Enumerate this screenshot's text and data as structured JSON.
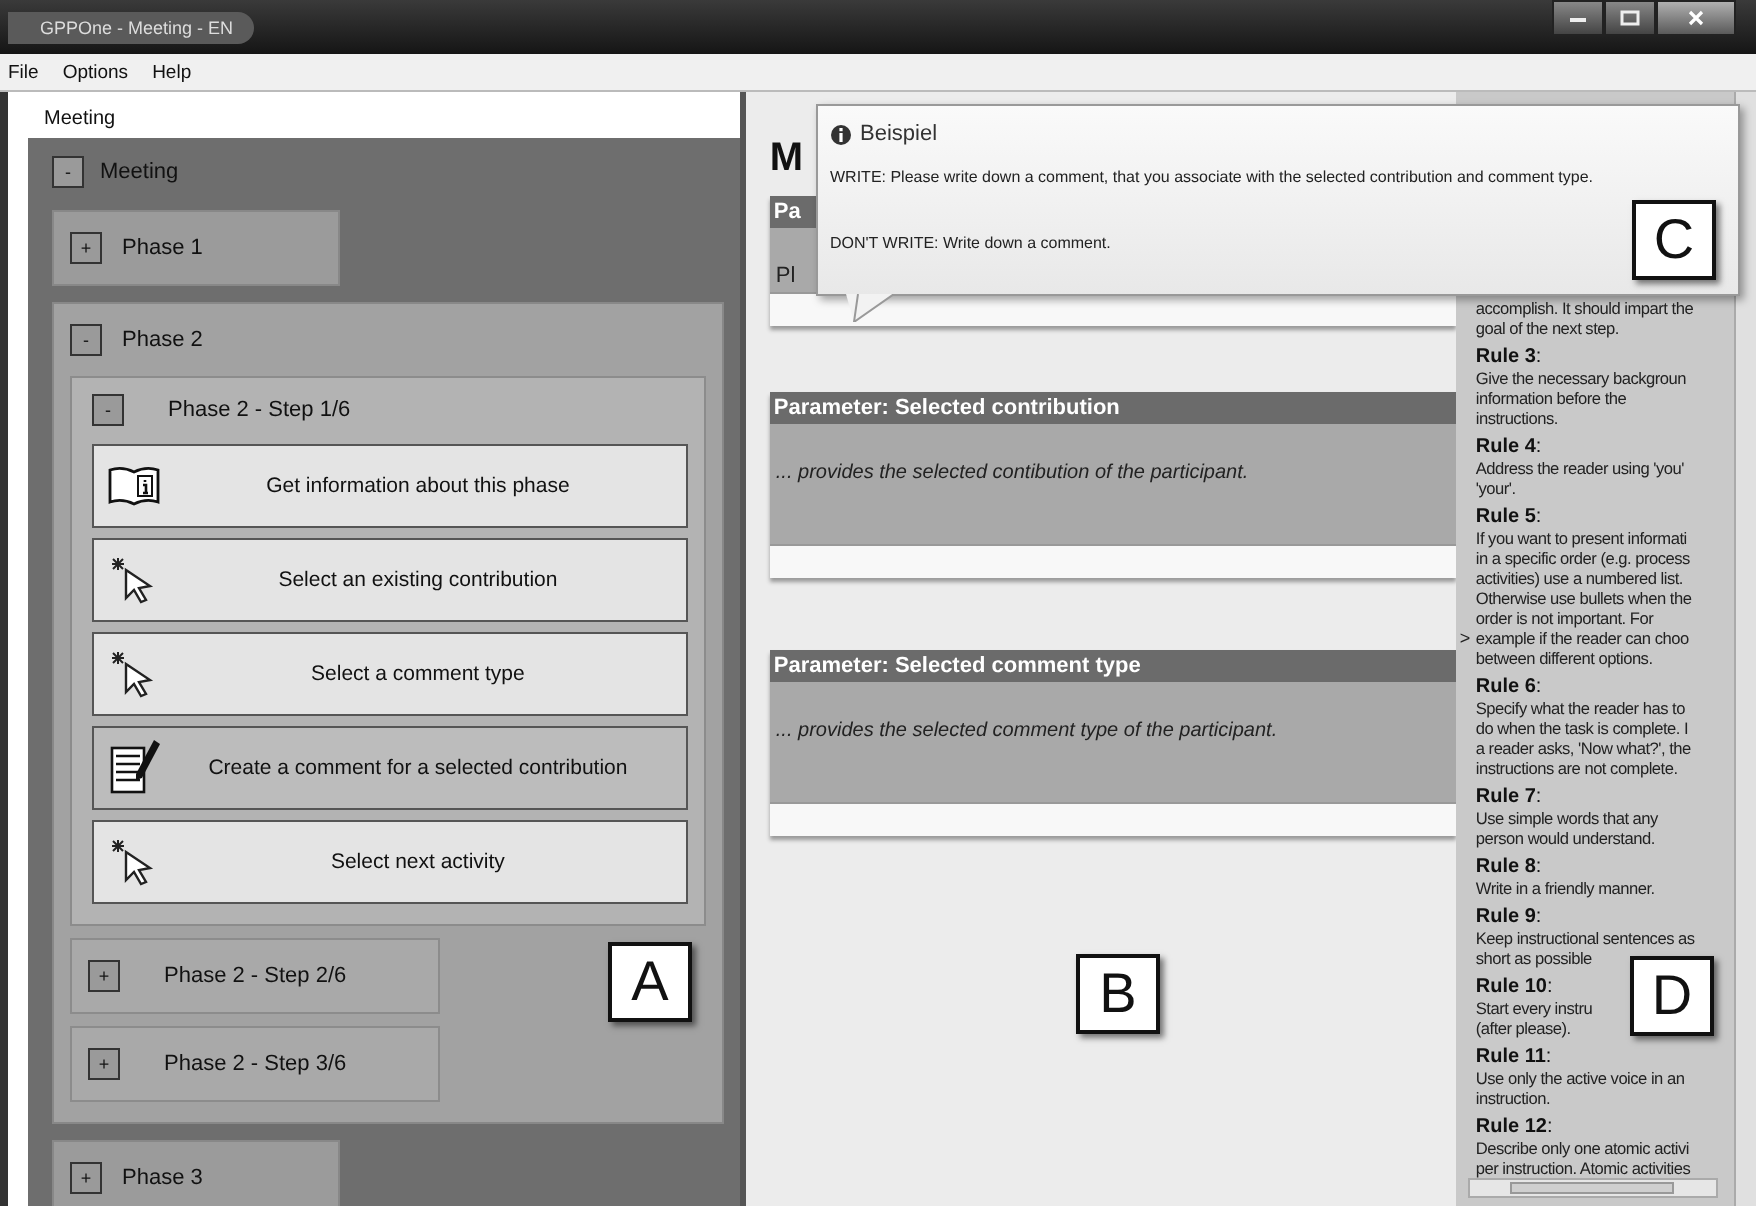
{
  "window": {
    "title": "GPPOne - Meeting - EN"
  },
  "menu": [
    "File",
    "Options",
    "Help"
  ],
  "left_panel": {
    "title": "Meeting",
    "callout": "A",
    "tree": {
      "toggle": "-",
      "label": "Meeting",
      "children": [
        {
          "toggle": "+",
          "label": "Phase 1"
        },
        {
          "toggle": "-",
          "label": "Phase 2",
          "children": [
            {
              "toggle": "-",
              "label": "Phase 2 - Step 1/6",
              "activities": [
                {
                  "kind": "info",
                  "label": "Get information about this phase",
                  "selected": false
                },
                {
                  "kind": "pointer",
                  "label": "Select an existing contribution",
                  "selected": false
                },
                {
                  "kind": "pointer",
                  "label": "Select a comment type",
                  "selected": false
                },
                {
                  "kind": "note",
                  "label": "Create a comment for a selected contribution",
                  "selected": true
                },
                {
                  "kind": "pointer",
                  "label": "Select next activity",
                  "selected": false
                }
              ]
            },
            {
              "toggle": "+",
              "label": "Phase 2 - Step 2/6"
            },
            {
              "toggle": "+",
              "label": "Phase 2 - Step 3/6"
            }
          ]
        },
        {
          "toggle": "+",
          "label": "Phase 3"
        }
      ]
    }
  },
  "center": {
    "heading": "M",
    "callout": "B",
    "parameters": [
      {
        "header": "Pa",
        "description": "Pl"
      },
      {
        "header": "Parameter: Selected contribution",
        "description": "... provides the selected contibution of the participant."
      },
      {
        "header": "Parameter: Selected comment type",
        "description": "... provides the selected comment type of the participant."
      }
    ]
  },
  "tooltip": {
    "title": "Beispiel",
    "callout": "C",
    "lines": [
      "WRITE: Please write down a comment, that you associate with the selected contribution and comment type.",
      "DON'T WRITE: Write down a comment."
    ]
  },
  "rules_panel": {
    "callout": "D",
    "arrow": ">",
    "continued_lines": [
      "accomplish. It should impart the",
      "goal of the next step."
    ],
    "rules": [
      {
        "title": "**Rule 3**:",
        "lines": [
          "Give the necessary backgroun",
          "information before the",
          "instructions."
        ]
      },
      {
        "title": "**Rule 4**:",
        "lines": [
          "Address the reader using 'you'",
          "'your'."
        ]
      },
      {
        "title": "**Rule 5**:",
        "lines": [
          "If you want to present informati",
          "in a specific order (e.g. process",
          "activities) use a numbered list.",
          "Otherwise use bullets when the",
          "order is not important. For",
          "example if the reader can choo",
          "between different options."
        ]
      },
      {
        "title": "**Rule 6**:",
        "lines": [
          "Specify what the reader has to",
          "do when the task is complete. I",
          "a reader asks, 'Now what?', the",
          "instructions are not complete."
        ]
      },
      {
        "title": "**Rule 7**:",
        "lines": [
          "Use simple words that any",
          "person would understand."
        ]
      },
      {
        "title": "**Rule 8**:",
        "lines": [
          "Write in a friendly manner."
        ]
      },
      {
        "title": "**Rule 9**:",
        "lines": [
          "Keep instructional sentences as",
          "short as possible"
        ]
      },
      {
        "title": "**Rule 10**:",
        "lines": [
          "Start every instru",
          "(after please)."
        ]
      },
      {
        "title": "**Rule 11**:",
        "lines": [
          "Use only the active voice in an",
          "instruction."
        ]
      },
      {
        "title": "**Rule 12**:",
        "lines": [
          "Describe only one atomic activi",
          "per instruction. Atomic activities"
        ]
      }
    ]
  }
}
